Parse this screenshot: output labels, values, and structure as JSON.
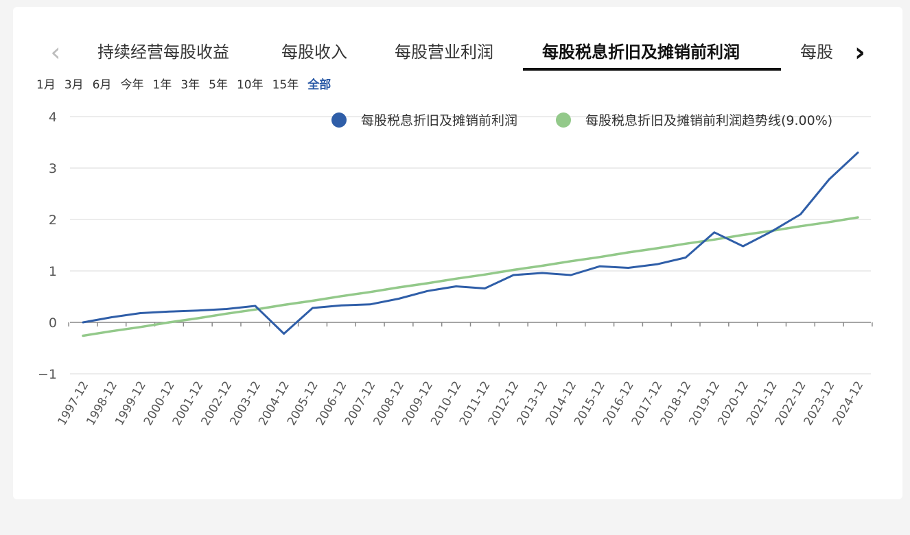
{
  "tabs": [
    {
      "label": "持续经营每股收益"
    },
    {
      "label": "每股收入"
    },
    {
      "label": "每股营业利润"
    },
    {
      "label": "每股税息折旧及摊销前利润",
      "active": true
    },
    {
      "label": "每股"
    }
  ],
  "nav": {
    "prev_icon": "chevron-left-icon",
    "next_icon": "chevron-right-icon"
  },
  "ranges": [
    {
      "label": "1月"
    },
    {
      "label": "3月"
    },
    {
      "label": "6月"
    },
    {
      "label": "今年"
    },
    {
      "label": "1年"
    },
    {
      "label": "3年"
    },
    {
      "label": "5年"
    },
    {
      "label": "10年"
    },
    {
      "label": "15年"
    },
    {
      "label": "全部",
      "active": true
    }
  ],
  "colors": {
    "accent": "#2b5aa6",
    "series_main": "#2f5ea8",
    "series_trend": "#93c98a",
    "grid": "#e6e6e6",
    "axis": "#888888"
  },
  "chart_data": {
    "type": "line",
    "categories": [
      "1997-12",
      "1998-12",
      "1999-12",
      "2000-12",
      "2001-12",
      "2002-12",
      "2003-12",
      "2004-12",
      "2005-12",
      "2006-12",
      "2007-12",
      "2008-12",
      "2009-12",
      "2010-12",
      "2011-12",
      "2012-12",
      "2013-12",
      "2014-12",
      "2015-12",
      "2016-12",
      "2017-12",
      "2018-12",
      "2019-12",
      "2020-12",
      "2021-12",
      "2022-12",
      "2023-12",
      "2024-12"
    ],
    "ylim": [
      -1,
      4
    ],
    "yticks": [
      "−1",
      "0",
      "1",
      "2",
      "3",
      "4"
    ],
    "ytick_values": [
      -1,
      0,
      1,
      2,
      3,
      4
    ],
    "series": [
      {
        "name": "每股税息折旧及摊销前利润",
        "values": [
          0.0,
          0.1,
          0.18,
          0.21,
          0.23,
          0.26,
          0.32,
          -0.22,
          0.28,
          0.33,
          0.35,
          0.46,
          0.61,
          0.7,
          0.66,
          0.92,
          0.96,
          0.92,
          1.09,
          1.06,
          1.13,
          1.26,
          1.75,
          1.48,
          1.77,
          2.1,
          2.78,
          3.3
        ]
      },
      {
        "name": "每股税息折旧及摊销前利润趋势线(9.00%)",
        "values": [
          -0.26,
          -0.17,
          -0.09,
          0.0,
          0.08,
          0.17,
          0.25,
          0.34,
          0.42,
          0.51,
          0.59,
          0.68,
          0.76,
          0.85,
          0.93,
          1.02,
          1.1,
          1.19,
          1.27,
          1.36,
          1.44,
          1.53,
          1.61,
          1.7,
          1.78,
          1.87,
          1.95,
          2.04
        ]
      }
    ],
    "legend": "top-right",
    "grid": true
  }
}
